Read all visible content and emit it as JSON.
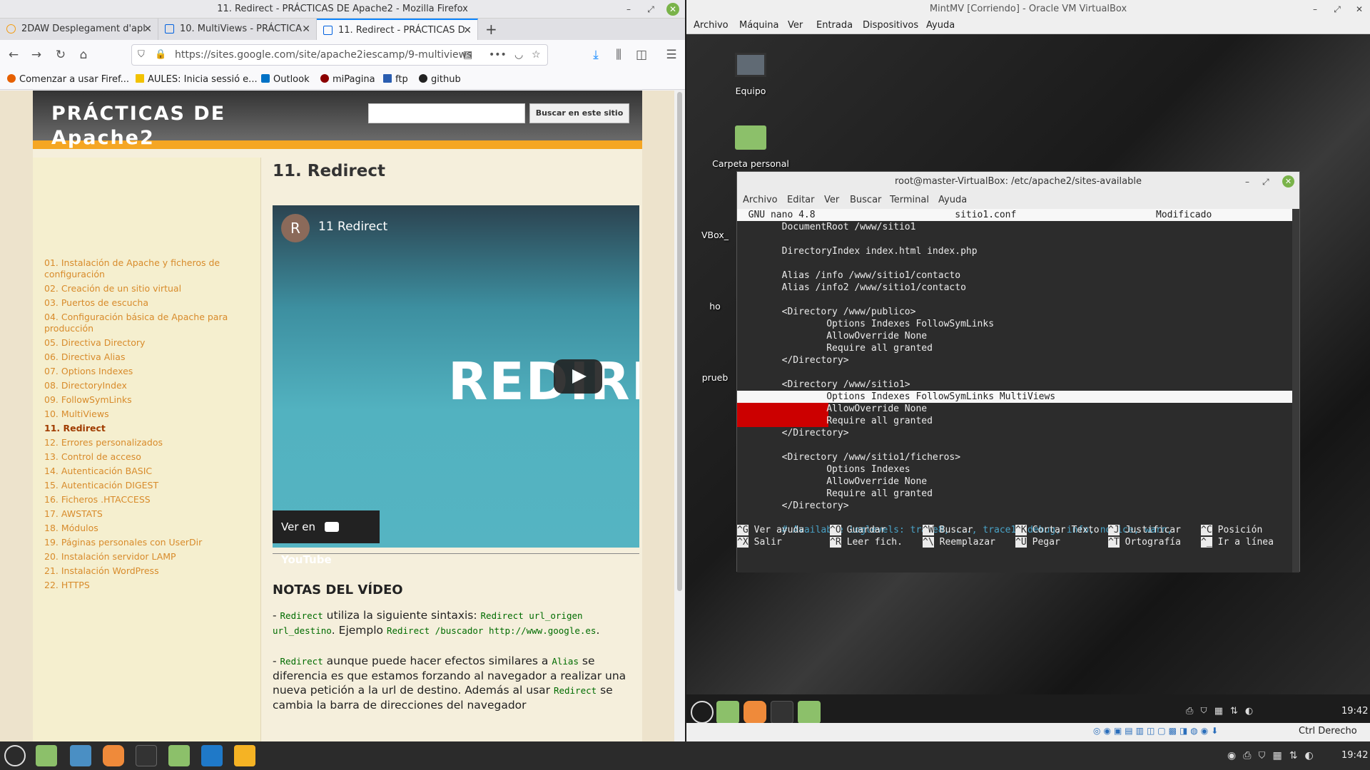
{
  "firefox": {
    "window_title": "11. Redirect - PRÁCTICAS DE Apache2 - Mozilla Firefox",
    "tabs": [
      {
        "label": "2DAW Desplegament d'apl"
      },
      {
        "label": "10. MultiViews - PRÁCTICA"
      },
      {
        "label": "11. Redirect - PRÁCTICAS D"
      }
    ],
    "url": "https://sites.google.com/site/apache2iescamp/9-multiviews",
    "bookmarks": [
      "Comenzar a usar Firef...",
      "AULES: Inicia sessió e...",
      "Outlook",
      "miPagina",
      "ftp",
      "github"
    ]
  },
  "site": {
    "title": "PRÁCTICAS DE Apache2",
    "search_button": "Buscar en este sitio",
    "nav": [
      "01. Instalación de Apache y ficheros de configuración",
      "02. Creación de un sitio virtual",
      "03. Puertos de escucha",
      "04. Configuración básica de Apache para producción",
      "05. Directiva Directory",
      "06. Directiva Alias",
      "07. Options Indexes",
      "08. DirectoryIndex",
      "09. FollowSymLinks",
      "10. MultiViews",
      "11. Redirect",
      "12. Errores personalizados",
      "13. Control de acceso",
      "14. Autenticación BASIC",
      "15. Autenticación DIGEST",
      "16. Ficheros .HTACCESS",
      "17. AWSTATS",
      "18. Módulos",
      "19. Páginas personales con UserDir",
      "20. Instalación servidor LAMP",
      "21. Instalación WordPress",
      "22. HTTPS"
    ],
    "page_heading": "11. Redirect",
    "video": {
      "avatar_letter": "R",
      "title": "11 Redirect",
      "big_text": "REDIRE",
      "watch_on": "Ver en",
      "youtube": "YouTube"
    },
    "notes_heading": "NOTAS DEL VÍDEO",
    "note1": {
      "dash": "- ",
      "c1": "Redirect",
      "t1": " utiliza la siguiente sintaxis: ",
      "c2": "Redirect url_origen url_destino",
      "t2": ". Ejemplo ",
      "c3": "Redirect /buscador http://www.google.es",
      "t3": "."
    },
    "note2": {
      "dash": "- ",
      "c1": "Redirect",
      "t1": " aunque puede hacer efectos similares a ",
      "c2": "Alias",
      "t2": " se diferencia es que estamos forzando al navegador a realizar una nueva petición a la url de destino. Además al usar ",
      "c3": "Redirect",
      "t3": " se cambia la barra de direcciones del navegador"
    }
  },
  "virtualbox": {
    "window_title": "MintMV [Corriendo] - Oracle VM VirtualBox",
    "menu": [
      "Archivo",
      "Máquina",
      "Ver",
      "Entrada",
      "Dispositivos",
      "Ayuda"
    ],
    "desktop_icons": [
      "Equipo",
      "Carpeta personal",
      "VBox_",
      "ho",
      "prueb"
    ],
    "status_right": "Ctrl Derecho",
    "vm_clock": "19:42"
  },
  "terminal": {
    "title": "root@master-VirtualBox: /etc/apache2/sites-available",
    "menu": [
      "Archivo",
      "Editar",
      "Ver",
      "Buscar",
      "Terminal",
      "Ayuda"
    ],
    "nano_header": "  GNU nano 4.8                         sitio1.conf                         Modificado ",
    "lines": [
      "        DocumentRoot /www/sitio1",
      "",
      "        DirectoryIndex index.html index.php",
      "",
      "        Alias /info /www/sitio1/contacto",
      "        Alias /info2 /www/sitio1/contacto",
      "",
      "        <Directory /www/publico>",
      "                Options Indexes FollowSymLinks",
      "                AllowOverride None",
      "                Require all granted",
      "        </Directory>",
      "",
      "        <Directory /www/sitio1>",
      "                Options Indexes FollowSymLinks MultiViews",
      "                AllowOverride None",
      "                Require all granted",
      "        </Directory>",
      "",
      "        <Directory /www/sitio1/ficheros>",
      "                Options Indexes",
      "                AllowOverride None",
      "                Require all granted",
      "        </Directory>",
      "",
      "        # Available loglevels: trace8, ..., trace1, debug, info, notice, warn,"
    ],
    "shortcuts": [
      [
        {
          "k": "^G",
          "l": "Ver ayuda"
        },
        {
          "k": "^O",
          "l": "Guardar"
        },
        {
          "k": "^W",
          "l": "Buscar"
        },
        {
          "k": "^K",
          "l": "Cortar Texto"
        },
        {
          "k": "^J",
          "l": "Justificar"
        },
        {
          "k": "^C",
          "l": "Posición"
        }
      ],
      [
        {
          "k": "^X",
          "l": "Salir"
        },
        {
          "k": "^R",
          "l": "Leer fich."
        },
        {
          "k": "^\\",
          "l": "Reemplazar"
        },
        {
          "k": "^U",
          "l": "Pegar"
        },
        {
          "k": "^T",
          "l": "Ortografía"
        },
        {
          "k": "^_",
          "l": "Ir a línea"
        }
      ]
    ]
  },
  "host": {
    "clock": "19:42"
  },
  "colors": {
    "accent_orange": "#f5a623",
    "link": "#d88b2b",
    "nano_red": "#cc0000",
    "comment": "#4aa3c7"
  }
}
